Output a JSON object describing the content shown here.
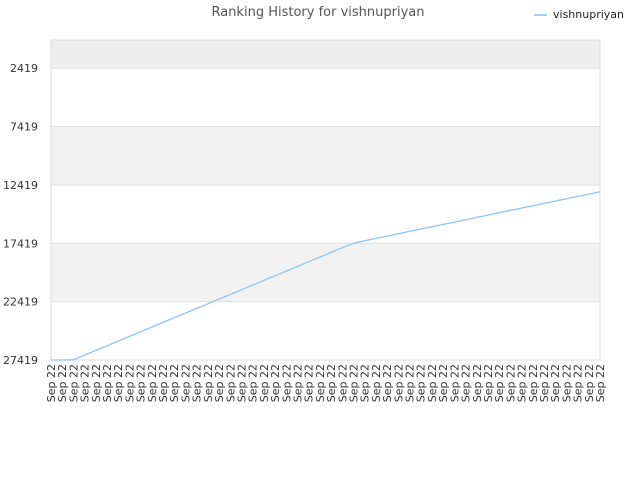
{
  "chart_data": {
    "type": "line",
    "title": "Ranking History for vishnupriyan",
    "xlabel": "",
    "ylabel": "",
    "y_inverted": true,
    "ylim": [
      27419,
      0
    ],
    "y_ticks": [
      2419,
      7419,
      12419,
      17419,
      22419,
      27419
    ],
    "x_tick_labels": [
      "Sep 22",
      "Sep 22",
      "Sep 22",
      "Sep 22",
      "Sep 22",
      "Sep 22",
      "Sep 22",
      "Sep 22",
      "Sep 22",
      "Sep 22",
      "Sep 22",
      "Sep 22",
      "Sep 22",
      "Sep 22",
      "Sep 22",
      "Sep 22",
      "Sep 22",
      "Sep 22",
      "Sep 22",
      "Sep 22",
      "Sep 22",
      "Sep 22",
      "Sep 22",
      "Sep 22",
      "Sep 22",
      "Sep 22",
      "Sep 22",
      "Sep 22",
      "Sep 22",
      "Sep 22",
      "Sep 22",
      "Sep 22",
      "Sep 22",
      "Sep 22",
      "Sep 22",
      "Sep 22",
      "Sep 22",
      "Sep 22",
      "Sep 22",
      "Sep 22",
      "Sep 22",
      "Sep 22",
      "Sep 22",
      "Sep 22",
      "Sep 22",
      "Sep 22",
      "Sep 22",
      "Sep 22",
      "Sep 22",
      "Sep 22"
    ],
    "grid": true,
    "legend_position": "top-right",
    "series": [
      {
        "name": "vishnupriyan",
        "color": "#8ec5f0",
        "values": [
          27419,
          27419,
          27400,
          27000,
          26600,
          26200,
          25800,
          25400,
          25000,
          24600,
          24200,
          23800,
          23400,
          23000,
          22600,
          22200,
          21800,
          21400,
          21000,
          20600,
          20200,
          19800,
          19400,
          19000,
          18600,
          18200,
          17800,
          17419,
          17200,
          17000,
          16800,
          16600,
          16400,
          16200,
          16000,
          15800,
          15600,
          15400,
          15200,
          15000,
          14800,
          14600,
          14400,
          14200,
          14000,
          13800,
          13600,
          13400,
          13200,
          13000
        ]
      }
    ]
  },
  "legend_items": [
    {
      "label": "vishnupriyan",
      "color": "#8ec5f0"
    }
  ]
}
